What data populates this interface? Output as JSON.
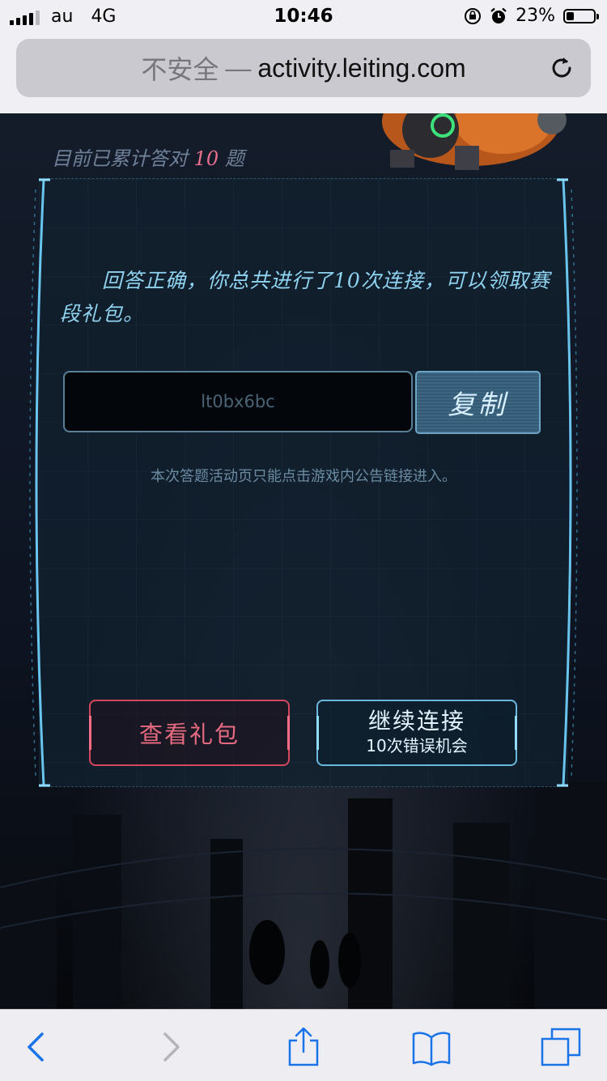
{
  "status_bar": {
    "carrier": "au",
    "network": "4G",
    "time": "10:46",
    "battery": "23%",
    "battery_level": 0.23
  },
  "browser": {
    "insecure_label": "不安全",
    "separator": "—",
    "host": "activity.leiting.com"
  },
  "page": {
    "counter_prefix": "目前已累计答对",
    "counter_value": "10",
    "counter_suffix": "题",
    "message": "回答正确，你总共进行了10次连接，可以领取赛段礼包。",
    "code_value": "lt0bx6bc",
    "copy_label": "复制",
    "notice": "本次答题活动页只能点击游戏内公告链接进入。",
    "view_gift_label": "查看礼包",
    "continue_label": "继续连接",
    "continue_sub": "10次错误机会",
    "colors": {
      "accent_pink": "#e66a7f",
      "accent_cyan": "#6ab7dd",
      "text_cyan": "#8fd3f0"
    }
  },
  "toolbar": {
    "icons": [
      "back-icon",
      "forward-icon",
      "share-icon",
      "bookmarks-icon",
      "tabs-icon"
    ]
  }
}
